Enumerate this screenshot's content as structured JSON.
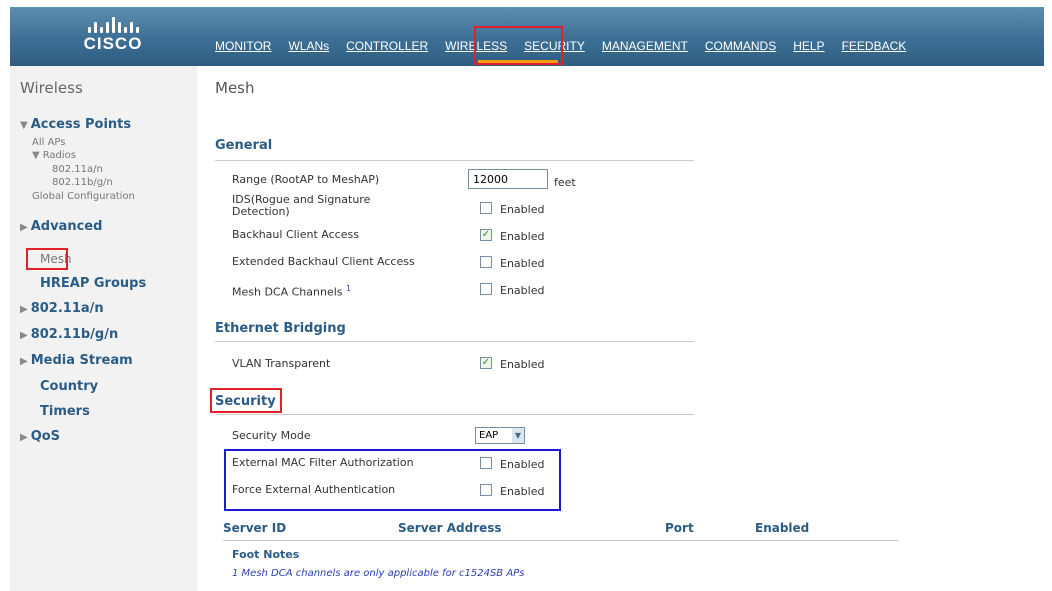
{
  "brand": {
    "name": "CISCO"
  },
  "nav": [
    "MONITOR",
    "WLANs",
    "CONTROLLER",
    "WIRELESS",
    "SECURITY",
    "MANAGEMENT",
    "COMMANDS",
    "HELP",
    "FEEDBACK"
  ],
  "sidebar": {
    "title": "Wireless",
    "access_points": "Access Points",
    "all_aps": "All APs",
    "radios": "Radios",
    "radio_a": "802.11a/n",
    "radio_bg": "802.11b/g/n",
    "global_config": "Global Configuration",
    "advanced": "Advanced",
    "mesh": "Mesh",
    "hreap": "HREAP Groups",
    "a_n": "802.11a/n",
    "bg_n": "802.11b/g/n",
    "media_stream": "Media Stream",
    "country": "Country",
    "timers": "Timers",
    "qos": "QoS"
  },
  "main": {
    "title": "Mesh",
    "general": "General",
    "range_label": "Range (RootAP to MeshAP)",
    "range_value": "12000",
    "range_unit": "feet",
    "ids_label": "IDS(Rogue and Signature Detection)",
    "backhaul_label": "Backhaul Client Access",
    "ext_backhaul_label": "Extended Backhaul Client Access",
    "dca_label": "Mesh DCA Channels",
    "dca_footnote_mark": "1",
    "ethernet": "Ethernet Bridging",
    "vlan_label": "VLAN Transparent",
    "security": "Security",
    "sec_mode_label": "Security Mode",
    "sec_mode_value": "EAP",
    "ext_mac_label": "External MAC Filter Authorization",
    "force_ext_label": "Force External Authentication",
    "enabled": "Enabled",
    "table_headers": [
      "Server ID",
      "Server Address",
      "Port",
      "Enabled"
    ],
    "foot_title": "Foot Notes",
    "foot_note": "1 Mesh DCA channels are only applicable for c1524SB APs"
  },
  "checks": {
    "ids": false,
    "backhaul": true,
    "ext_backhaul": false,
    "dca": false,
    "vlan": true,
    "ext_mac": false,
    "force_ext": false
  },
  "colors": {
    "header": "#3d6f95",
    "accent_red": "#e0212b",
    "blue_box": "#1a1ad6",
    "section": "#2a5c86"
  }
}
